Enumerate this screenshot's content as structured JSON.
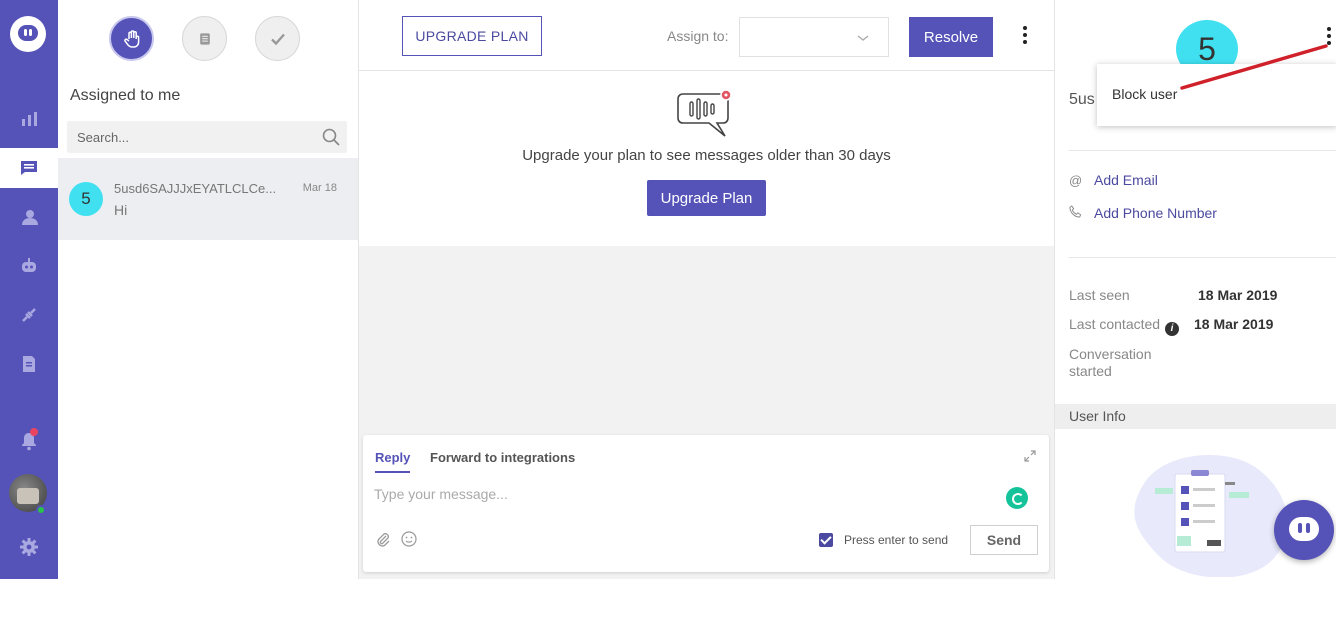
{
  "nav": {
    "items": [
      "reports-icon",
      "conversations-icon",
      "users-icon",
      "bot-icon",
      "integrations-icon",
      "docs-icon",
      "notifications-icon",
      "settings-icon"
    ]
  },
  "list": {
    "title": "Assigned to me",
    "search_placeholder": "Search...",
    "conversation": {
      "avatar_letter": "5",
      "name": "5usd6SAJJJxEYATLCLCe...",
      "date": "Mar 18",
      "message": "Hi"
    }
  },
  "main": {
    "upgrade_plan_label": "UPGRADE PLAN",
    "assign_label": "Assign to:",
    "resolve_label": "Resolve",
    "upgrade_message": "Upgrade your plan to see messages older than 30 days",
    "upgrade_button": "Upgrade Plan"
  },
  "composer": {
    "tab_reply": "Reply",
    "tab_forward": "Forward to integrations",
    "placeholder": "Type your message...",
    "press_enter": "Press enter to send",
    "send_label": "Send"
  },
  "right": {
    "avatar_letter": "5",
    "name_partial": "5us",
    "dropdown_item": "Block user",
    "add_email": "Add Email",
    "add_phone": "Add Phone Number",
    "last_seen_label": "Last seen",
    "last_seen_value": "18 Mar 2019",
    "last_contacted_label": "Last contacted",
    "last_contacted_value": "18 Mar 2019",
    "conversation_started_label": "Conversation started",
    "user_info_label": "User Info"
  },
  "colors": {
    "brand": "#5553b7",
    "avatar": "#40e0f0",
    "annotation": "#d0202a"
  }
}
